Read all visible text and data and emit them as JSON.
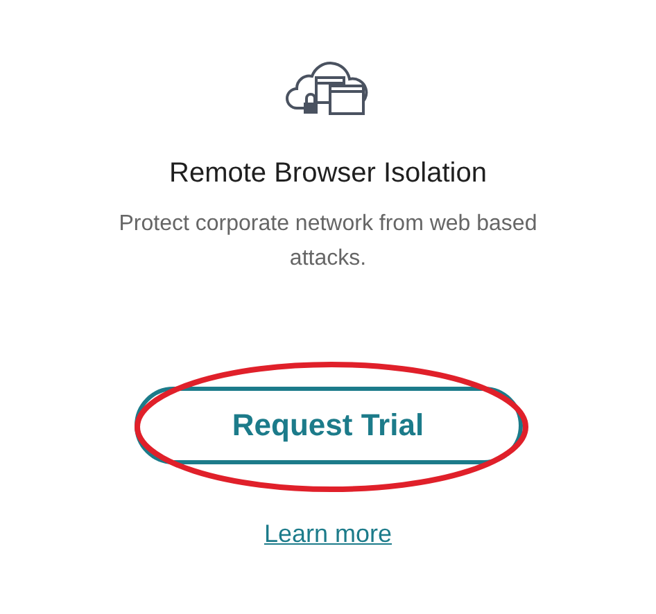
{
  "card": {
    "title": "Remote Browser Isolation",
    "description": "Protect corporate network from web based attacks.",
    "button": {
      "label": "Request Trial",
      "annotated": true
    },
    "link": "Learn more"
  }
}
